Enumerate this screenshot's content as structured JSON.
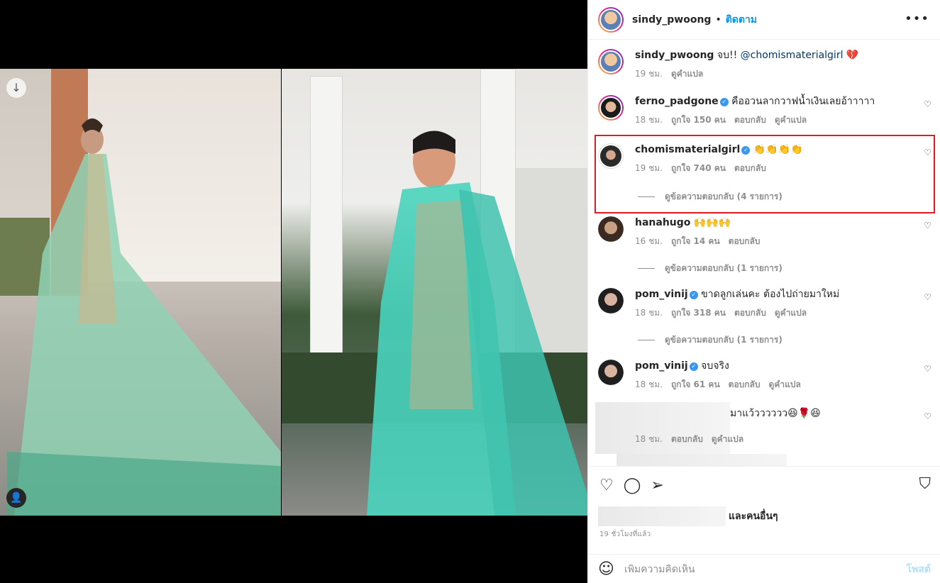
{
  "post": {
    "author": "sindy_pwoong",
    "separator": "•",
    "follow_label": "ติดตาม",
    "more_icon": "ellipsis-icon"
  },
  "caption": {
    "username": "sindy_pwoong",
    "text": "จบ!! ",
    "mention": "@chomismaterialgirl",
    "emoji": "💔",
    "time": "19 ชม.",
    "translate": "ดูคำแปล"
  },
  "comments": [
    {
      "username": "ferno_padgone",
      "verified": true,
      "text": "คืออวนลากวาฟน้ำเงินเลยอ้าาาาา",
      "time": "18 ชม.",
      "likes": "ถูกใจ 150 คน",
      "reply": "ตอบกลับ",
      "translate": "ดูคำแปล"
    },
    {
      "username": "chomismaterialgirl",
      "verified": true,
      "text": "👏👏👏👏",
      "time": "19 ชม.",
      "likes": "ถูกใจ 740 คน",
      "reply": "ตอบกลับ",
      "view_replies": "ดูข้อความตอบกลับ (4 รายการ)"
    },
    {
      "username": "hanahugo",
      "verified": false,
      "text": "🙌🙌🙌",
      "time": "16 ชม.",
      "likes": "ถูกใจ 14 คน",
      "reply": "ตอบกลับ",
      "view_replies": "ดูข้อความตอบกลับ (1 รายการ)"
    },
    {
      "username": "pom_vinij",
      "verified": true,
      "text": "ขาดลูกเล่นคะ ต้องไปถ่ายมาใหม่",
      "time": "18 ชม.",
      "likes": "ถูกใจ 318 คน",
      "reply": "ตอบกลับ",
      "translate": "ดูคำแปล",
      "view_replies": "ดูข้อความตอบกลับ (1 รายการ)"
    },
    {
      "username": "pom_vinij",
      "verified": true,
      "text": "จบจริง",
      "time": "18 ชม.",
      "likes": "ถูกใจ 61 คน",
      "reply": "ตอบกลับ",
      "translate": "ดูคำแปล"
    },
    {
      "username": "",
      "verified": false,
      "text": "มาแว้วววววว😆🌹😆",
      "time": "18 ชม.",
      "reply": "ตอบกลับ",
      "translate": "ดูคำแปล"
    }
  ],
  "footer": {
    "liked_by_suffix": "และคนอื่นๆ",
    "time_ago": "19 ชั่วโมงที่แล้ว",
    "comment_placeholder": "เพิ่มความคิดเห็น",
    "post_label": "โพสต์",
    "icons": [
      "heart-icon",
      "comment-icon",
      "share-icon",
      "bookmark-icon",
      "emoji-icon"
    ]
  },
  "colors": {
    "accent": "#0095f6",
    "highlight": "#e11b22",
    "muted": "#8e8e8e",
    "verified": "#3897f0"
  }
}
